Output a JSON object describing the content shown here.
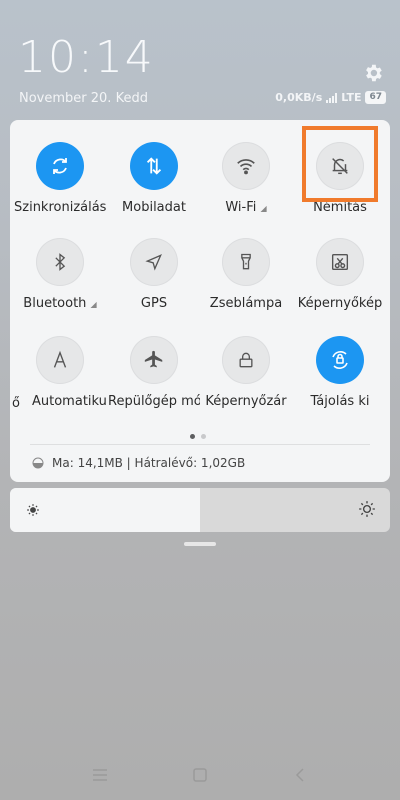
{
  "lockscreen": {
    "time": "10:14",
    "date": "November 20. Kedd",
    "net_speed": "0,0KB/s",
    "network": "LTE",
    "battery": "67"
  },
  "tiles": [
    {
      "label": "Szinkronizálás",
      "icon": "sync-icon",
      "active": true
    },
    {
      "label": "Mobiladat",
      "icon": "mobile-data-icon",
      "active": true
    },
    {
      "label": "Wi-Fi",
      "icon": "wifi-icon",
      "active": false,
      "has_caret": true
    },
    {
      "label": "Némítás",
      "icon": "mute-bell-icon",
      "active": false,
      "highlighted": true
    },
    {
      "label": "Bluetooth",
      "icon": "bluetooth-icon",
      "active": false,
      "has_caret": true
    },
    {
      "label": "GPS",
      "icon": "location-icon",
      "active": false
    },
    {
      "label": "Zseblámpa",
      "icon": "flashlight-icon",
      "active": false
    },
    {
      "label": "Képernyőkép",
      "icon": "screenshot-icon",
      "active": false
    },
    {
      "label": "Automatikus fényerő",
      "icon": "auto-brightness-icon",
      "active": false
    },
    {
      "label": "Repülőgép mód",
      "icon": "airplane-icon",
      "active": false
    },
    {
      "label": "Képernyőzár",
      "icon": "lock-icon",
      "active": false
    },
    {
      "label": "Tájolás ki",
      "icon": "rotation-lock-icon",
      "active": true
    }
  ],
  "left_edge_fragment": "ő",
  "memory": "Ma: 14,1MB | Hátralévő: 1,02GB",
  "brightness_level": 0.5,
  "colors": {
    "accent": "#1c96f2",
    "highlight": "#f07a2c"
  }
}
